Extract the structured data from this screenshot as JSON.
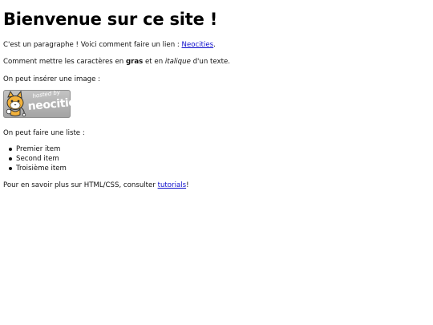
{
  "title": "Bienvenue sur ce site !",
  "paragraph1": {
    "before": "C'est un paragraphe ! Voici comment faire un lien : ",
    "link": "Neocities",
    "after": "."
  },
  "paragraph2": {
    "before": "Comment mettre les caractères en ",
    "bold": "gras",
    "middle": " et en ",
    "italic": "italique",
    "after": " d'un texte."
  },
  "paragraph3": "On peut insérer une image :",
  "badge": {
    "small": "hosted by",
    "big": "neocities",
    "colors": {
      "background": "#b4b4b4",
      "mascot": "#f2b13a",
      "outline": "#333333"
    }
  },
  "paragraph4": "On peut faire une liste :",
  "list": [
    "Premier item",
    "Second item",
    "Troisième item"
  ],
  "paragraph5": {
    "before": "Pour en savoir plus sur HTML/CSS, consulter ",
    "link": "tutorials",
    "after": "!"
  },
  "colors": {
    "link": "#1010cc",
    "text": "#111111",
    "background": "#ffffff"
  }
}
